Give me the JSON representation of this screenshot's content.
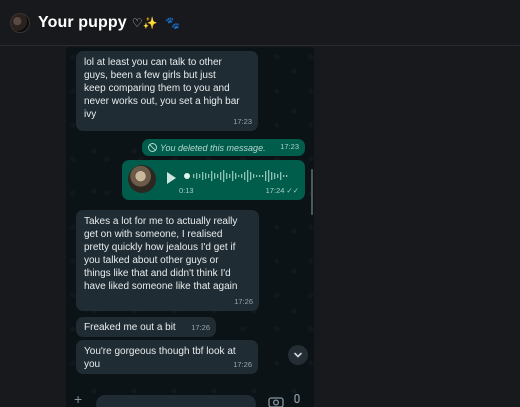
{
  "header": {
    "title": "Your puppy",
    "title_emoji": "♡✨",
    "paw": "🐾"
  },
  "chat": {
    "messages": [
      {
        "kind": "incoming",
        "text": "lol at least you can talk to other\nguys, been a few girls but just\nkeep comparing them to you and\nnever works out, you set a high bar\nivy",
        "time": "17:23"
      },
      {
        "kind": "outgoing-deleted",
        "text": "You deleted this message.",
        "time": "17:23"
      },
      {
        "kind": "outgoing-voice",
        "duration": "0:13",
        "time": "17:24",
        "read": "✓✓"
      },
      {
        "kind": "incoming",
        "text": "Takes a lot for me to actually really\nget on with someone, I realised\npretty quickly how jealous I'd get if\nyou talked about other guys or\nthings like that and didn't think I'd\nhave liked someone like that again",
        "time": "17:26"
      },
      {
        "kind": "incoming",
        "text": "Freaked me out a bit",
        "time": "17:26"
      },
      {
        "kind": "incoming",
        "text": "You're gorgeous though tbf look at\nyou",
        "time": "17:26"
      }
    ]
  },
  "icons": {
    "scroll_down": "chevron-down-icon",
    "attach": "plus-icon",
    "camera": "camera-icon",
    "mic": "mic-icon"
  },
  "input": {
    "plus": "+"
  },
  "colors": {
    "incoming_bubble": "#1f2c33",
    "outgoing_bubble": "#005c4b",
    "chat_background": "#0c1317",
    "page_background": "#18191c"
  }
}
